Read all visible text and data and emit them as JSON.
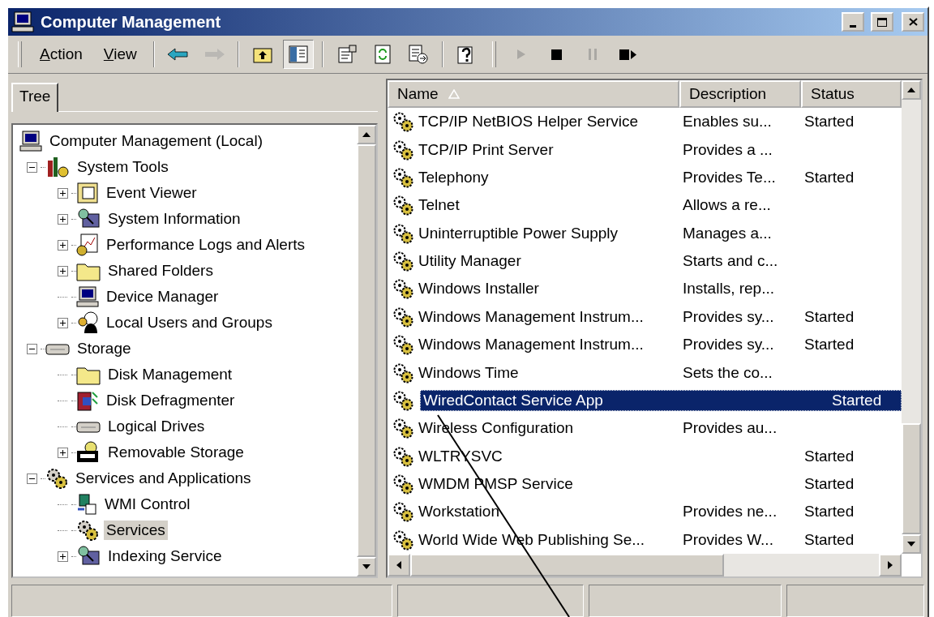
{
  "window": {
    "title": "Computer Management"
  },
  "toolbar": {
    "menus": [
      "Action",
      "View"
    ],
    "groups": [
      [
        {
          "kind": "back",
          "disabled": false,
          "on": false
        },
        {
          "kind": "forward",
          "disabled": true,
          "on": false
        }
      ],
      [
        {
          "kind": "up",
          "disabled": false,
          "on": false
        },
        {
          "kind": "tree",
          "disabled": false,
          "on": true
        }
      ],
      [
        {
          "kind": "properties",
          "disabled": false,
          "on": false
        },
        {
          "kind": "refresh",
          "disabled": false,
          "on": false
        },
        {
          "kind": "export",
          "disabled": false,
          "on": false
        }
      ],
      [
        {
          "kind": "help",
          "disabled": false,
          "on": false
        }
      ],
      [
        {
          "kind": "play",
          "disabled": true,
          "on": false
        },
        {
          "kind": "stop",
          "disabled": false,
          "on": false
        },
        {
          "kind": "pause",
          "disabled": true,
          "on": false
        },
        {
          "kind": "restart",
          "disabled": false,
          "on": false
        }
      ]
    ]
  },
  "left_pane": {
    "tab": "Tree",
    "tree": [
      {
        "label": "Computer Management (Local)",
        "selected": false,
        "children": [
          {
            "label": "System Tools",
            "expanded": true,
            "selected": false,
            "children": [
              {
                "label": "Event Viewer",
                "expanded": false,
                "selected": false
              },
              {
                "label": "System Information",
                "expanded": false,
                "selected": false
              },
              {
                "label": "Performance Logs and Alerts",
                "expanded": false,
                "selected": false
              },
              {
                "label": "Shared Folders",
                "expanded": false,
                "selected": false
              },
              {
                "label": "Device Manager",
                "selected": false
              },
              {
                "label": "Local Users and Groups",
                "expanded": false,
                "selected": false
              }
            ]
          },
          {
            "label": "Storage",
            "expanded": true,
            "selected": false,
            "children": [
              {
                "label": "Disk Management",
                "selected": false
              },
              {
                "label": "Disk Defragmenter",
                "selected": false
              },
              {
                "label": "Logical Drives",
                "selected": false
              },
              {
                "label": "Removable Storage",
                "expanded": false,
                "selected": false
              }
            ]
          },
          {
            "label": "Services and Applications",
            "expanded": true,
            "selected": false,
            "children": [
              {
                "label": "WMI Control",
                "selected": false
              },
              {
                "label": "Services",
                "selected": true
              },
              {
                "label": "Indexing Service",
                "expanded": false,
                "selected": false
              }
            ]
          }
        ]
      }
    ]
  },
  "list": {
    "columns": [
      {
        "label": "Name",
        "sorted": true
      },
      {
        "label": "Description",
        "sorted": false
      },
      {
        "label": "Status",
        "sorted": false
      }
    ],
    "rows": [
      {
        "name": "TCP/IP NetBIOS Helper Service",
        "description": "Enables su...",
        "status": "Started",
        "selected": false
      },
      {
        "name": "TCP/IP Print Server",
        "description": "Provides a ...",
        "status": "",
        "selected": false
      },
      {
        "name": "Telephony",
        "description": "Provides Te...",
        "status": "Started",
        "selected": false
      },
      {
        "name": "Telnet",
        "description": "Allows a re...",
        "status": "",
        "selected": false
      },
      {
        "name": "Uninterruptible Power Supply",
        "description": "Manages a...",
        "status": "",
        "selected": false
      },
      {
        "name": "Utility Manager",
        "description": "Starts and c...",
        "status": "",
        "selected": false
      },
      {
        "name": "Windows Installer",
        "description": "Installs, rep...",
        "status": "",
        "selected": false
      },
      {
        "name": "Windows Management Instrum...",
        "description": "Provides sy...",
        "status": "Started",
        "selected": false
      },
      {
        "name": "Windows Management Instrum...",
        "description": "Provides sy...",
        "status": "Started",
        "selected": false
      },
      {
        "name": "Windows Time",
        "description": "Sets the co...",
        "status": "",
        "selected": false
      },
      {
        "name": "WiredContact Service App",
        "description": "",
        "status": "Started",
        "selected": true
      },
      {
        "name": "Wireless Configuration",
        "description": "Provides au...",
        "status": "",
        "selected": false
      },
      {
        "name": "WLTRYSVC",
        "description": "",
        "status": "Started",
        "selected": false
      },
      {
        "name": "WMDM PMSP Service",
        "description": "",
        "status": "Started",
        "selected": false
      },
      {
        "name": "Workstation",
        "description": "Provides ne...",
        "status": "Started",
        "selected": false
      },
      {
        "name": "World Wide Web Publishing Se...",
        "description": "Provides W...",
        "status": "Started",
        "selected": false
      }
    ]
  }
}
